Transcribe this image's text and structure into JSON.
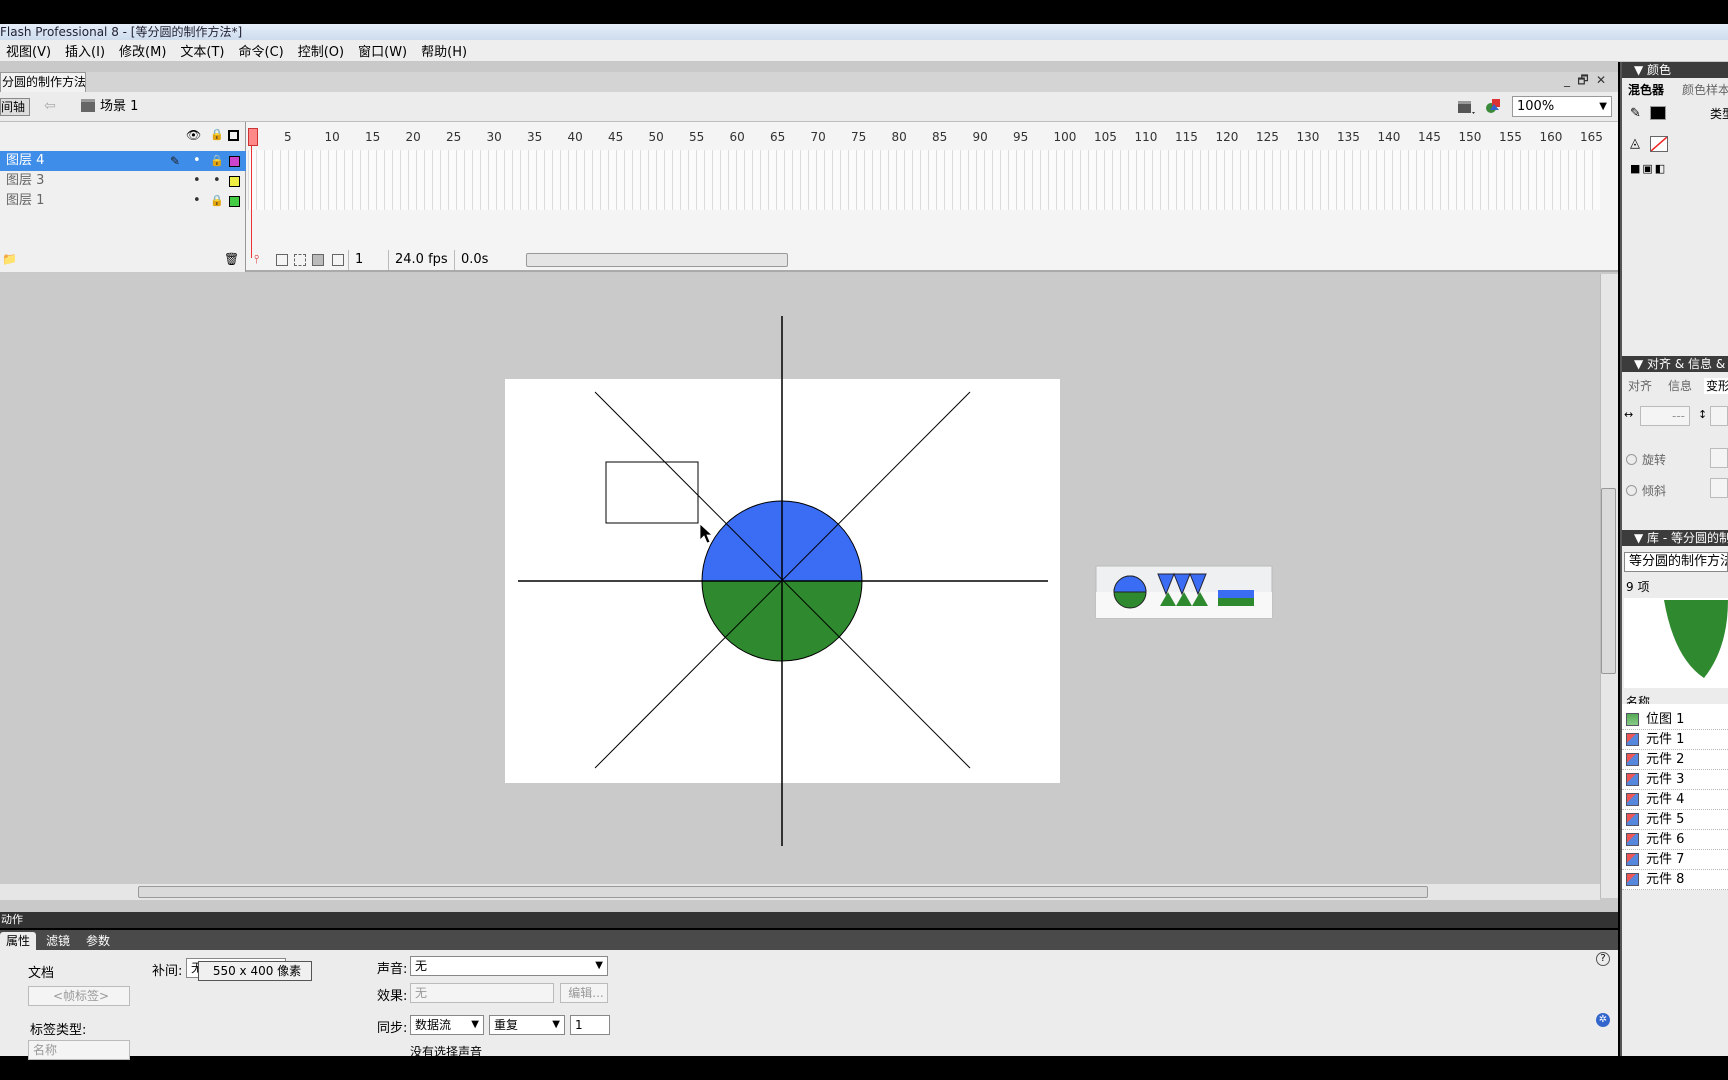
{
  "window": {
    "title": "Flash Professional 8 - [等分圆的制作方法*]",
    "controls": [
      "_",
      "🗗",
      "✕"
    ]
  },
  "menu": [
    "视图(V)",
    "插入(I)",
    "修改(M)",
    "文本(T)",
    "命令(C)",
    "控制(O)",
    "窗口(W)",
    "帮助(H)"
  ],
  "document": {
    "tab_label": "分圆的制作方法*",
    "timeline_button": "间轴",
    "scene": "场景 1",
    "zoom": "100%"
  },
  "timeline": {
    "layers": [
      {
        "name": "图层 4",
        "selected": true
      },
      {
        "name": "图层 3",
        "selected": false
      },
      {
        "name": "图层 1",
        "selected": false
      }
    ],
    "ticks": [
      "1",
      "5",
      "10",
      "15",
      "20",
      "25",
      "30",
      "35",
      "40",
      "45",
      "50",
      "55",
      "60",
      "65",
      "70",
      "75",
      "80",
      "85",
      "90",
      "95",
      "100",
      "105",
      "110",
      "115",
      "120",
      "125",
      "130",
      "135",
      "140",
      "145",
      "150",
      "155",
      "160",
      "165"
    ],
    "current_frame": "1",
    "fps": "24.0 fps",
    "elapsed": "0.0s"
  },
  "stage": {
    "circle_top_color": "#3a6cf4",
    "circle_bottom_color": "#2f8a2f"
  },
  "panels": {
    "actions": "动作",
    "props_tabs": [
      "属性",
      "滤镜",
      "参数"
    ],
    "doc_label": "文档",
    "frame_label_placeholder": "<帧标签>",
    "label_type": "标签类型:",
    "label_name": "名称",
    "tween_label": "补间:",
    "tween_value": "无",
    "stage_size": "550 x 400 像素",
    "sound_label": "声音:",
    "sound_value": "无",
    "effect_label": "效果:",
    "effect_value": "无",
    "edit_button": "编辑...",
    "sync_label": "同步:",
    "sync_value": "数据流",
    "repeat_value": "重复",
    "repeat_count": "1",
    "no_sound": "没有选择声音"
  },
  "right": {
    "color_header": "▼ 颜色",
    "color_tabs": [
      "混色器",
      "颜色样本"
    ],
    "type_label": "类型",
    "align_header": "▼ 对齐 & 信息 & 变形",
    "align_tabs": [
      "对齐",
      "信息",
      "变形"
    ],
    "width_value": "---",
    "rotate_label": "旋转",
    "skew_label": "倾斜",
    "library_header": "▼ 库 - 等分圆的制作方法",
    "library_select": "等分圆的制作方法",
    "item_count": "9 项",
    "name_col": "名称",
    "items": [
      "位图 1",
      "元件 1",
      "元件 2",
      "元件 3",
      "元件 4",
      "元件 5",
      "元件 6",
      "元件 7",
      "元件 8"
    ]
  }
}
